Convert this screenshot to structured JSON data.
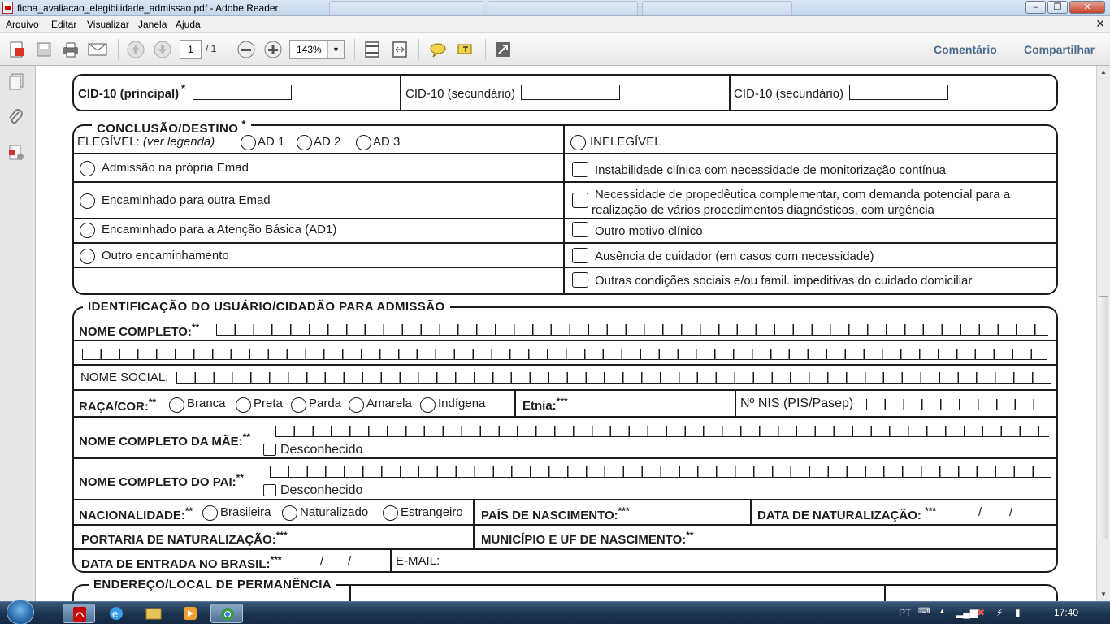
{
  "window": {
    "title": "ficha_avaliacao_elegibilidade_admissao.pdf - Adobe Reader"
  },
  "menu": [
    "Arquivo",
    "Editar",
    "Visualizar",
    "Janela",
    "Ajuda"
  ],
  "toolbar": {
    "page_current": "1",
    "page_total": "/ 1",
    "zoom": "143%",
    "comment": "Comentário",
    "share": "Compartilhar"
  },
  "icons": [
    "create-pdf-icon",
    "save-icon",
    "print-icon",
    "email-icon",
    "previous-page-icon",
    "next-page-icon",
    "zoom-out-icon",
    "zoom-in-icon",
    "fit-page-icon",
    "fit-width-icon",
    "comment-bubble-icon",
    "highlight-icon",
    "fullscreen-icon",
    "pages-icon",
    "attachments-icon",
    "signature-icon"
  ],
  "form": {
    "cid": {
      "principal": "CID-10 (principal)",
      "secundario1": "CID-10 (secundário)",
      "secundario2": "CID-10 (secundário)",
      "ast": "*"
    },
    "conclusao": {
      "title": "CONCLUSÃO/DESTINO",
      "ast": "*",
      "elegivel": "ELEGÍVEL:",
      "ver_legenda": "(ver legenda)",
      "ad": [
        "AD 1",
        "AD 2",
        "AD 3"
      ],
      "inelegivel": "INELEGÍVEL",
      "left_options": [
        "Admissão na própria Emad",
        "Encaminhado para outra Emad",
        "Encaminhado para a Atenção Básica (AD1)",
        "Outro encaminhamento"
      ],
      "right_options": [
        "Instabilidade clínica com necessidade de monitorização contínua",
        "Necessidade de propedêutica complementar, com demanda potencial para a",
        "realização de vários procedimentos diagnósticos, com urgência",
        "Outro motivo clínico",
        "Ausência de cuidador (em casos com necessidade)",
        "Outras condições sociais e/ou famil. impeditivas do cuidado domiciliar"
      ]
    },
    "identificacao": {
      "title": "IDENTIFICAÇÃO DO USUÁRIO/CIDADÃO PARA ADMISSÃO",
      "nome_completo": "NOME COMPLETO:",
      "nome_social": "NOME SOCIAL:",
      "raca": "RAÇA/COR:",
      "racas": [
        "Branca",
        "Preta",
        "Parda",
        "Amarela",
        "Indígena"
      ],
      "etnia": "Etnia:",
      "nis": "Nº NIS (PIS/Pasep)",
      "mae": "NOME COMPLETO DA MÃE:",
      "pai": "NOME COMPLETO DO PAI:",
      "desconhecido": "Desconhecido",
      "nacionalidade": "NACIONALIDADE:",
      "nacionalidades": [
        "Brasileira",
        "Naturalizado",
        "Estrangeiro"
      ],
      "pais": "PAÍS DE NASCIMENTO:",
      "data_nat": "DATA DE NATURALIZAÇÃO:",
      "portaria": "PORTARIA DE NATURALIZAÇÃO:",
      "municipio": "MUNICÍPIO E UF DE NASCIMENTO:",
      "data_entrada": "DATA DE ENTRADA NO BRASIL:",
      "email": "E-MAIL:",
      "slash": "/",
      "a2": "**",
      "a3": "***"
    },
    "endereco": {
      "title": "ENDEREÇO/LOCAL DE PERMANÊNCIA",
      "a2": "**"
    }
  },
  "taskbar": {
    "lang": "PT",
    "time": "17:40"
  }
}
